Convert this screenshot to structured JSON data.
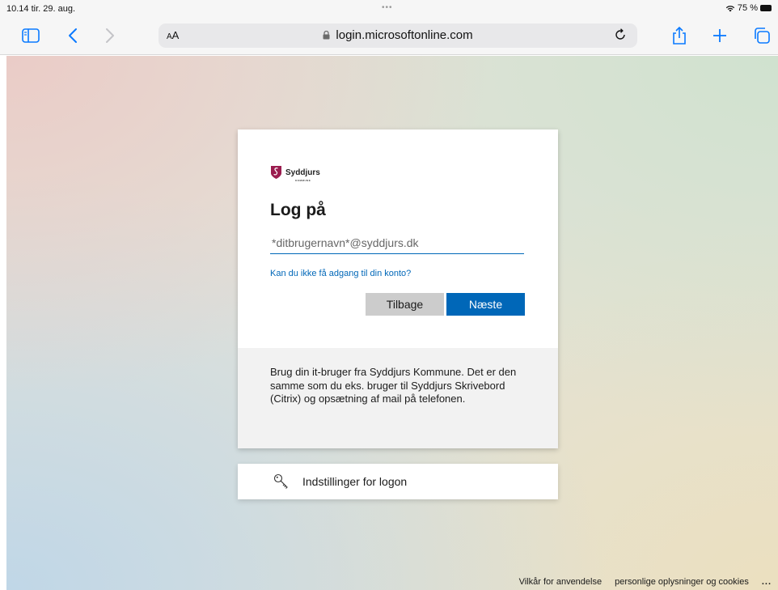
{
  "status_bar": {
    "time": "10.14 tir. 29. aug.",
    "center_dots": "•••",
    "battery_text": "75 %"
  },
  "browser": {
    "text_size_label_small": "A",
    "text_size_label_large": "A",
    "url": "login.microsoftonline.com",
    "icons": [
      "sidebar-icon",
      "back-icon",
      "forward-icon",
      "lock-icon",
      "reload-icon",
      "share-icon",
      "plus-icon",
      "tabs-icon"
    ]
  },
  "signin": {
    "logo_name": "Syddjurs",
    "logo_sub": "KOMMUNE",
    "title": "Log på",
    "input_placeholder": "*ditbrugernavn*@syddjurs.dk",
    "input_value": "",
    "help_link": "Kan du ikke få adgang til din konto?",
    "back_button": "Tilbage",
    "next_button": "Næste",
    "info_text": "Brug din it-bruger fra Syddjurs Kommune. Det er den samme som du eks. bruger til Syddjurs Skrivebord (Citrix) og opsætning af mail på telefonen.",
    "brand_color": "#0067b8"
  },
  "options": {
    "label": "Indstillinger for logon"
  },
  "footer": {
    "terms": "Vilkår for anvendelse",
    "privacy": "personlige oplysninger og cookies",
    "more": "..."
  }
}
